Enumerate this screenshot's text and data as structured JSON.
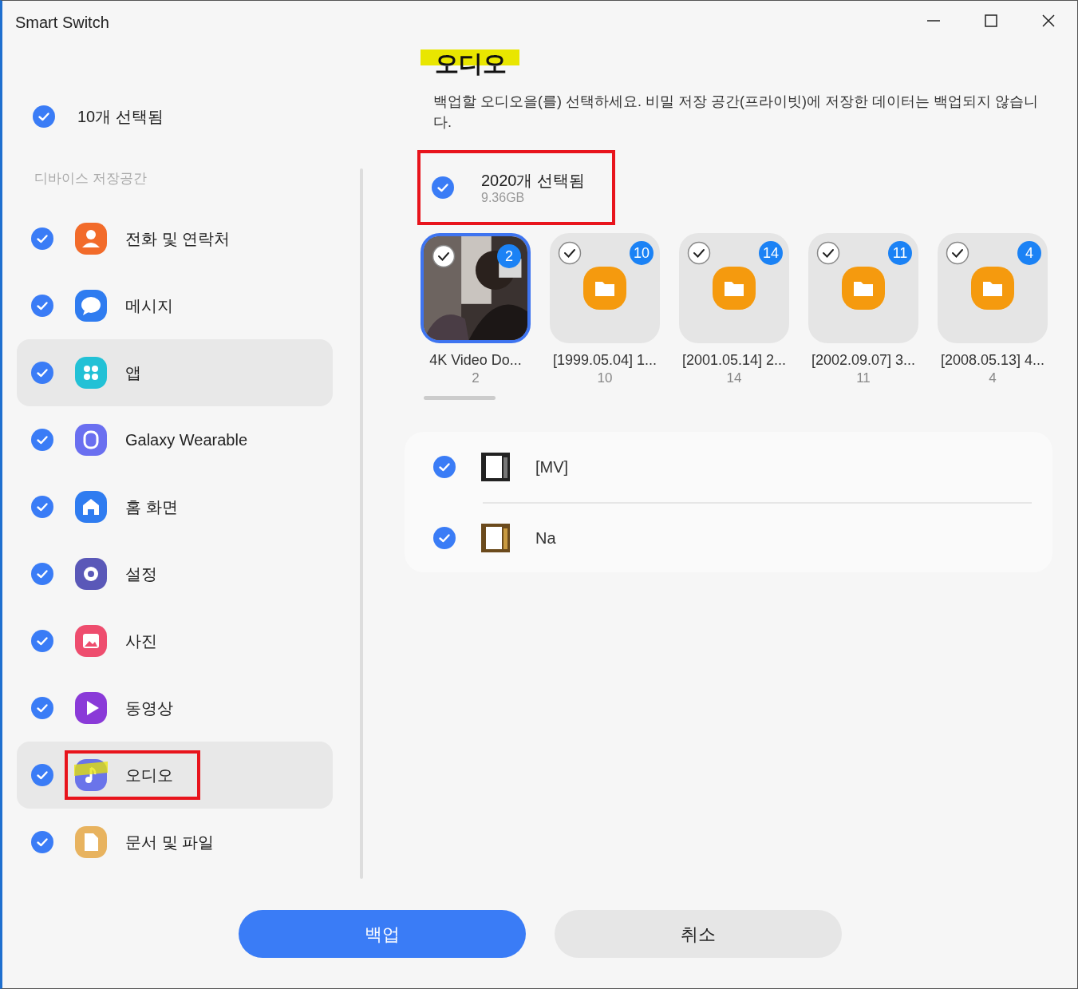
{
  "window": {
    "title": "Smart Switch"
  },
  "sidebar": {
    "summary": {
      "label": "10개 선택됨",
      "checked": true
    },
    "section": "디바이스 저장공간",
    "items": [
      {
        "kind": "contacts",
        "label": "전화 및 연락처",
        "checked": true,
        "selected": false,
        "annotated": false
      },
      {
        "kind": "messages",
        "label": "메시지",
        "checked": true,
        "selected": false,
        "annotated": false
      },
      {
        "kind": "apps",
        "label": "앱",
        "checked": true,
        "selected": true,
        "annotated": false
      },
      {
        "kind": "wearable",
        "label": "Galaxy Wearable",
        "checked": true,
        "selected": false,
        "annotated": false
      },
      {
        "kind": "home",
        "label": "홈 화면",
        "checked": true,
        "selected": false,
        "annotated": false
      },
      {
        "kind": "settings",
        "label": "설정",
        "checked": true,
        "selected": false,
        "annotated": false
      },
      {
        "kind": "photos",
        "label": "사진",
        "checked": true,
        "selected": false,
        "annotated": false
      },
      {
        "kind": "videos",
        "label": "동영상",
        "checked": true,
        "selected": false,
        "annotated": false
      },
      {
        "kind": "audio",
        "label": "오디오",
        "checked": true,
        "selected": true,
        "annotated": true
      },
      {
        "kind": "documents",
        "label": "문서 및 파일",
        "checked": true,
        "selected": false,
        "annotated": false
      }
    ]
  },
  "content": {
    "title": "오디오",
    "description": "백업할 오디오을(를) 선택하세요. 비밀 저장 공간(프라이빗)에 저장한 데이터는 백업되지 않습니다.",
    "summary": {
      "label": "2020개 선택됨",
      "size": "9.36GB",
      "checked": true,
      "annotated": true
    },
    "folders": [
      {
        "kind": "picture",
        "name": "4K Video Do...",
        "count": "2",
        "badge": "2",
        "selected": true
      },
      {
        "kind": "folder",
        "name": "[1999.05.04] 1...",
        "count": "10",
        "badge": "10",
        "selected": false
      },
      {
        "kind": "folder",
        "name": "[2001.05.14] 2...",
        "count": "14",
        "badge": "14",
        "selected": false
      },
      {
        "kind": "folder",
        "name": "[2002.09.07] 3...",
        "count": "11",
        "badge": "11",
        "selected": false
      },
      {
        "kind": "folder",
        "name": "[2008.05.13] 4...",
        "count": "4",
        "badge": "4",
        "selected": false
      }
    ],
    "files": [
      {
        "name": "[MV]",
        "checked": true
      },
      {
        "name": "Na",
        "checked": true
      }
    ]
  },
  "buttons": [
    {
      "kind": "primary",
      "label": "백업"
    },
    {
      "kind": "secondary",
      "label": "취소"
    }
  ]
}
